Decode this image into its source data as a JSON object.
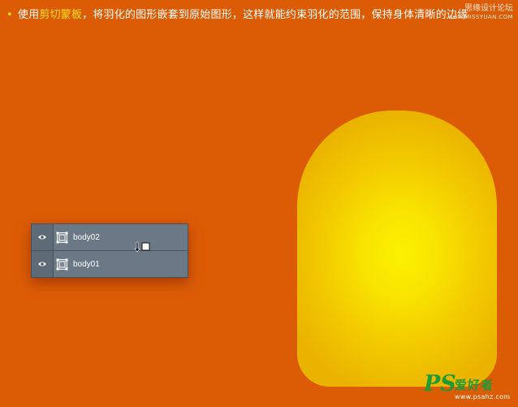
{
  "caption": {
    "bullet": "•",
    "pre": "使用",
    "highlight": "剪切蒙板",
    "post": "，将羽化的图形嵌套到原始图形，这样就能约束羽化的范围，保持身体清晰的边缘"
  },
  "watermark_top": {
    "text": "思缘设计论坛",
    "url": "www.MISSYUAN.COM"
  },
  "layers": [
    {
      "name": "body02",
      "eye_icon": "eye-icon",
      "thumb_icon": "smart-object-icon"
    },
    {
      "name": "body01",
      "eye_icon": "eye-icon",
      "thumb_icon": "smart-object-icon"
    }
  ],
  "clip_cursor_icon": "clipping-mask-cursor-icon",
  "colors": {
    "background": "#dc5c06",
    "highlight_text": "#ffe31a",
    "panel": "#6b7885",
    "capsule_center": "#fbf200",
    "capsule_edge": "#eab300",
    "logo_green": "#1f9a34"
  },
  "watermark_bottom": {
    "logo": "PS",
    "title": "爱好者",
    "url": "www.psahz.com"
  }
}
